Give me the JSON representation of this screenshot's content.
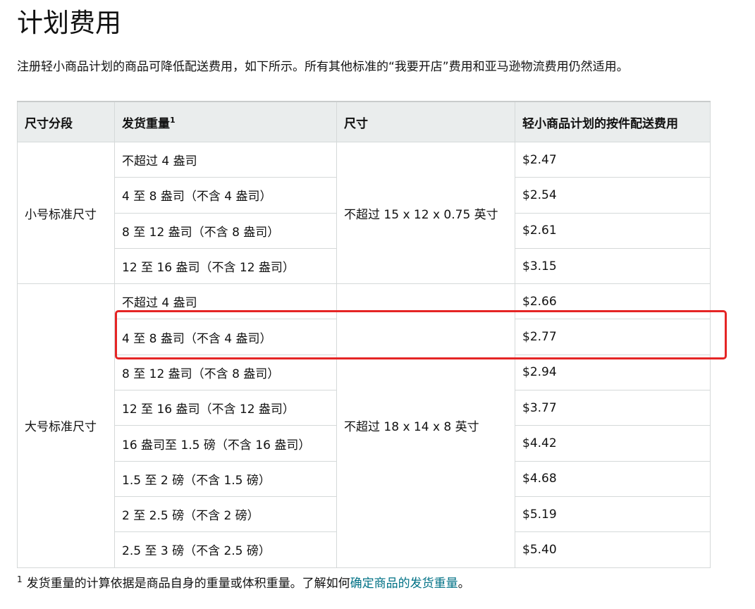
{
  "page": {
    "title": "计划费用",
    "intro": "注册轻小商品计划的商品可降低配送费用，如下所示。所有其他标准的“我要开店”费用和亚马逊物流费用仍然适用。"
  },
  "table": {
    "headers": {
      "size_tier": "尺寸分段",
      "weight": "发货重量",
      "weight_sup": "1",
      "dimensions": "尺寸",
      "fee": "轻小商品计划的按件配送费用"
    },
    "groups": [
      {
        "tier": "小号标准尺寸",
        "dimensions": "不超过 15 x 12 x 0.75 英寸",
        "rows": [
          {
            "weight": "不超过 4 盎司",
            "fee": "$2.47"
          },
          {
            "weight": "4 至 8 盎司（不含 4 盎司）",
            "fee": "$2.54"
          },
          {
            "weight": "8 至 12 盎司（不含 8 盎司）",
            "fee": "$2.61"
          },
          {
            "weight": "12 至 16 盎司（不含 12 盎司）",
            "fee": "$3.15"
          }
        ]
      },
      {
        "tier": "大号标准尺寸",
        "dimensions": "不超过 18 x 14 x 8 英寸",
        "rows": [
          {
            "weight": "不超过 4 盎司",
            "fee": "$2.66"
          },
          {
            "weight": "4 至 8 盎司（不含 4 盎司）",
            "fee": "$2.77"
          },
          {
            "weight": "8 至 12 盎司（不含 8 盎司）",
            "fee": "$2.94"
          },
          {
            "weight": "12 至 16 盎司（不含 12 盎司）",
            "fee": "$3.77"
          },
          {
            "weight": "16 盎司至 1.5 磅（不含 16 盎司）",
            "fee": "$4.42"
          },
          {
            "weight": "1.5 至 2 磅（不含 1.5 磅）",
            "fee": "$4.68"
          },
          {
            "weight": "2 至 2.5 磅（不含 2 磅）",
            "fee": "$5.19"
          },
          {
            "weight": "2.5 至 3 磅（不含 2.5 磅）",
            "fee": "$5.40"
          }
        ]
      }
    ]
  },
  "annotation": {
    "color": "#e52525"
  },
  "footnote": {
    "mark": "1",
    "text": "发货重量的计算依据是商品自身的重量或体积重量。了解如何",
    "link": "确定商品的发货重量",
    "end": "。"
  },
  "colors": {
    "header_bg": "#eaeded",
    "border": "#d5d9d9",
    "link": "#007185"
  }
}
